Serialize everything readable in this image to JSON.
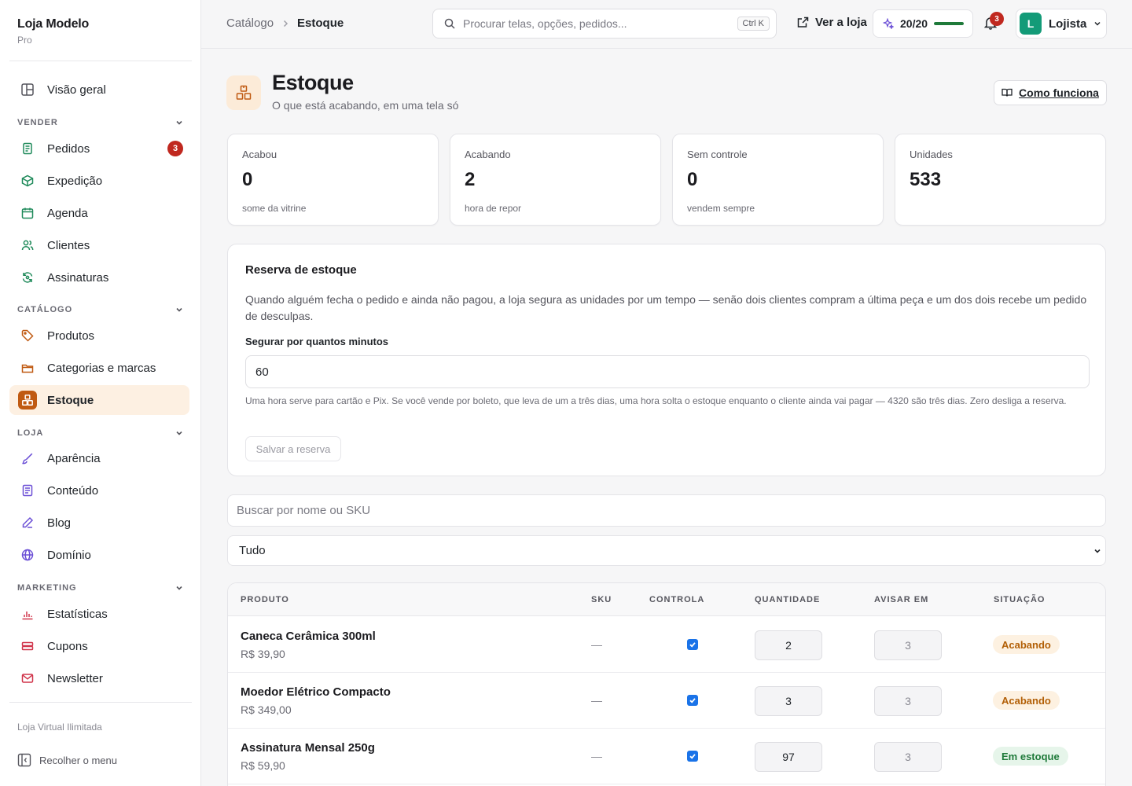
{
  "brand": {
    "name": "Loja Modelo",
    "plan": "Pro"
  },
  "colors": {
    "accent": "#c05a12",
    "accent_bg": "#fdf0e2",
    "badge": "#c0281f",
    "success": "#1f7a3a",
    "warning": "#b25f06",
    "checkbox": "#1a73e8"
  },
  "sidebar": {
    "overview": {
      "label": "Visão geral",
      "icon": "layout-icon"
    },
    "sections": [
      {
        "title": "VENDER",
        "items": [
          {
            "label": "Pedidos",
            "icon": "receipt-icon",
            "badge": "3"
          },
          {
            "label": "Expedição",
            "icon": "package-icon"
          },
          {
            "label": "Agenda",
            "icon": "calendar-icon"
          },
          {
            "label": "Clientes",
            "icon": "users-icon"
          },
          {
            "label": "Assinaturas",
            "icon": "refresh-icon"
          }
        ]
      },
      {
        "title": "CATÁLOGO",
        "items": [
          {
            "label": "Produtos",
            "icon": "tag-icon"
          },
          {
            "label": "Categorias e marcas",
            "icon": "folder-icon"
          },
          {
            "label": "Estoque",
            "icon": "boxes-icon",
            "active": true
          }
        ]
      },
      {
        "title": "LOJA",
        "items": [
          {
            "label": "Aparência",
            "icon": "brush-icon"
          },
          {
            "label": "Conteúdo",
            "icon": "document-icon"
          },
          {
            "label": "Blog",
            "icon": "pen-icon"
          },
          {
            "label": "Domínio",
            "icon": "globe-icon"
          }
        ]
      },
      {
        "title": "MARKETING",
        "items": [
          {
            "label": "Estatísticas",
            "icon": "bar-chart-icon"
          },
          {
            "label": "Cupons",
            "icon": "ticket-icon"
          },
          {
            "label": "Newsletter",
            "icon": "mail-icon"
          }
        ]
      }
    ],
    "footer_text": "Loja Virtual Ilimitada",
    "collapse_label": "Recolher o menu"
  },
  "topbar": {
    "breadcrumb": {
      "parent": "Catálogo",
      "current": "Estoque"
    },
    "search_placeholder": "Procurar telas, opções, pedidos...",
    "search_shortcut": "Ctrl K",
    "view_store_label": "Ver a loja",
    "quota": {
      "label": "20/20",
      "fraction": 1.0
    },
    "notifications_count": "3",
    "user": {
      "initial": "L",
      "name": "Lojista"
    }
  },
  "page": {
    "title": "Estoque",
    "subtitle": "O que está acabando, em uma tela só",
    "help_button": "Como funciona"
  },
  "stats": [
    {
      "label": "Acabou",
      "value": "0",
      "hint": "some da vitrine"
    },
    {
      "label": "Acabando",
      "value": "2",
      "hint": "hora de repor"
    },
    {
      "label": "Sem controle",
      "value": "0",
      "hint": "vendem sempre"
    },
    {
      "label": "Unidades",
      "value": "533",
      "hint": ""
    }
  ],
  "reserve": {
    "title": "Reserva de estoque",
    "description": "Quando alguém fecha o pedido e ainda não pagou, a loja segura as unidades por um tempo — senão dois clientes compram a última peça e um dos dois recebe um pedido de desculpas.",
    "field_label": "Segurar por quantos minutos",
    "field_value": "60",
    "help": "Uma hora serve para cartão e Pix. Se você vende por boleto, que leva de um a três dias, uma hora solta o estoque enquanto o cliente ainda vai pagar — 4320 são três dias. Zero desliga a reserva.",
    "save_label": "Salvar a reserva"
  },
  "filters": {
    "search_placeholder": "Buscar por nome ou SKU",
    "status_value": "Tudo"
  },
  "table": {
    "columns": {
      "product": "PRODUTO",
      "sku": "SKU",
      "controls": "CONTROLA",
      "quantity": "QUANTIDADE",
      "warn_at": "AVISAR EM",
      "status": "SITUAÇÃO"
    },
    "rows": [
      {
        "name": "Caneca Cerâmica 300ml",
        "price": "R$ 39,90",
        "sku": "—",
        "controls": true,
        "quantity": "2",
        "warn_at": "3",
        "status": "Acabando",
        "status_kind": "low"
      },
      {
        "name": "Moedor Elétrico Compacto",
        "price": "R$ 349,00",
        "sku": "—",
        "controls": true,
        "quantity": "3",
        "warn_at": "3",
        "status": "Acabando",
        "status_kind": "low"
      },
      {
        "name": "Assinatura Mensal 250g",
        "price": "R$ 59,90",
        "sku": "—",
        "controls": true,
        "quantity": "97",
        "warn_at": "3",
        "status": "Em estoque",
        "status_kind": "ok"
      }
    ]
  }
}
